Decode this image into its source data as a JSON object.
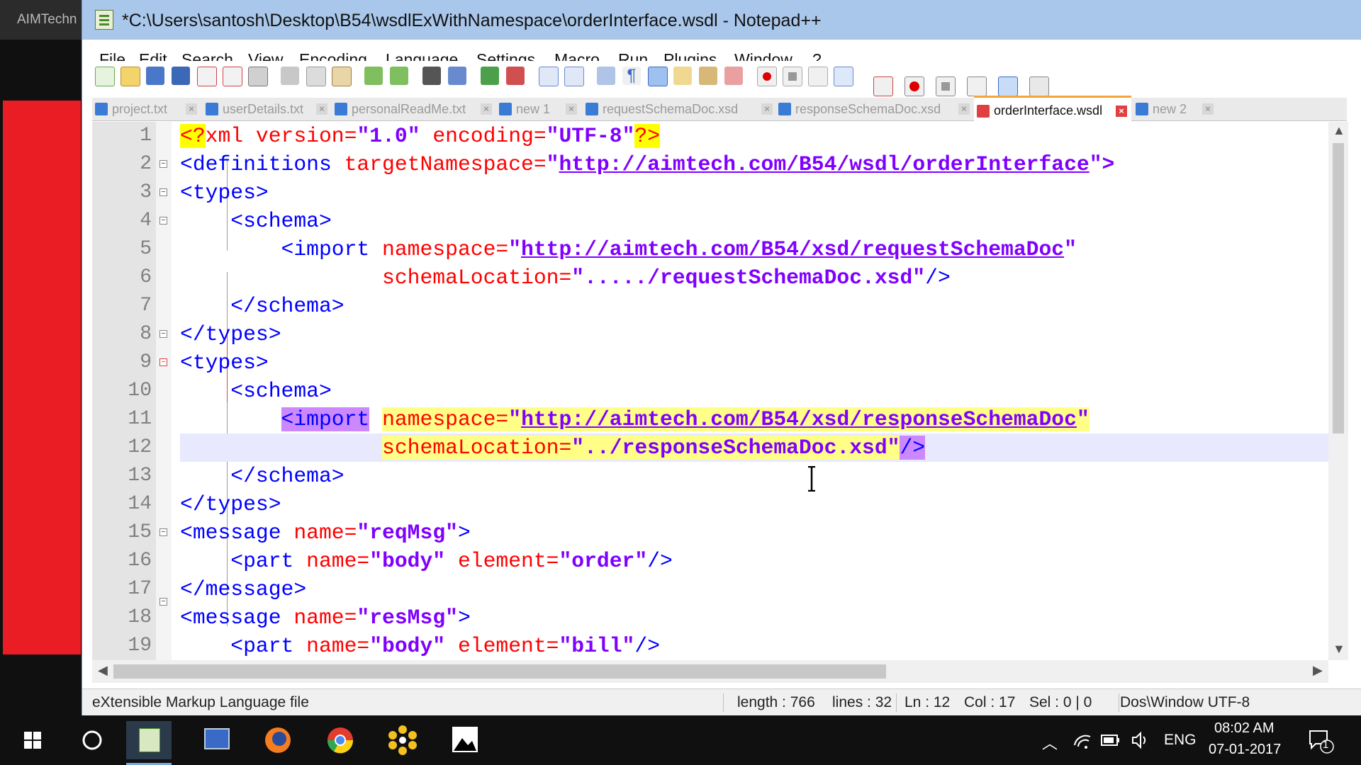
{
  "background": {
    "left_title": "AIMTechn"
  },
  "window": {
    "title": "*C:\\Users\\santosh\\Desktop\\B54\\wsdlExWithNamespace\\orderInterface.wsdl - Notepad++"
  },
  "menu": [
    "File",
    "Edit",
    "Search",
    "View",
    "Encoding",
    "Language",
    "Settings",
    "Macro",
    "Run",
    "Plugins",
    "Window",
    "?"
  ],
  "tabs": [
    {
      "label": "project.txt",
      "active": false
    },
    {
      "label": "userDetails.txt",
      "active": false
    },
    {
      "label": "personalReadMe.txt",
      "active": false
    },
    {
      "label": "new 1",
      "active": false
    },
    {
      "label": "requestSchemaDoc.xsd",
      "active": false
    },
    {
      "label": "responseSchemaDoc.xsd",
      "active": false
    },
    {
      "label": "orderInterface.wsdl",
      "active": true
    },
    {
      "label": "new 2",
      "active": false
    }
  ],
  "editor": {
    "line_numbers": [
      "1",
      "2",
      "3",
      "4",
      "5",
      "6",
      "7",
      "8",
      "9",
      "10",
      "11",
      "12",
      "13",
      "14",
      "15",
      "16",
      "17",
      "18",
      "19"
    ],
    "code_text": {
      "l1_a": "<?",
      "l1_b": "xml ",
      "l1_c": "version=",
      "l1_d": "\"1.0\"",
      "l1_e": " encoding=",
      "l1_f": "\"UTF-8\"",
      "l1_g": "?>",
      "l2_a": "<definitions ",
      "l2_b": "targetNamespace=",
      "l2_c": "\"",
      "l2_d": "http://aimtech.com/B54/wsdl/orderInterface",
      "l2_e": "\">",
      "l3": "<types>",
      "l4": "    <schema>",
      "l5_a": "        <import ",
      "l5_b": "namespace=",
      "l5_c": "\"",
      "l5_d": "http://aimtech.com/B54/xsd/requestSchemaDoc",
      "l5_e": "\"",
      "l6_a": "                ",
      "l6_b": "schemaLocation=",
      "l6_c": "\"...../requestSchemaDoc.xsd\"",
      "l6_d": "/>",
      "l7": "    </schema>",
      "l8": "</types>",
      "l9": "<types>",
      "l10": "    <schema>",
      "l11_a": "        ",
      "l11_b": "<import",
      "l11_c": " ",
      "l11_d": "namespace=",
      "l11_e": "\"",
      "l11_f": "http://aimtech.com/B54/xsd/responseSchemaDoc",
      "l11_g": "\"",
      "l12_a": "                ",
      "l12_b": "schemaLocation=",
      "l12_c": "\"../responseSchemaDoc.xsd\"",
      "l12_d": "/>",
      "l13": "    </schema>",
      "l14": "</types>",
      "l15_a": "<message ",
      "l15_b": "name=",
      "l15_c": "\"reqMsg\"",
      "l15_d": ">",
      "l16_a": "    <part ",
      "l16_b": "name=",
      "l16_c": "\"body\"",
      "l16_d": " element=",
      "l16_e": "\"order\"",
      "l16_f": "/>",
      "l17": "</message>",
      "l18_a": "<message ",
      "l18_b": "name=",
      "l18_c": "\"resMsg\"",
      "l18_d": ">",
      "l19_a": "    <part ",
      "l19_b": "name=",
      "l19_c": "\"body\"",
      "l19_d": " element=",
      "l19_e": "\"bill\"",
      "l19_f": "/>"
    }
  },
  "status": {
    "file_type": "eXtensible Markup Language file",
    "length": "length : 766",
    "lines": "lines : 32",
    "ln": "Ln : 12",
    "col": "Col : 17",
    "sel": "Sel : 0 | 0",
    "eol_enc": "Dos\\Window UTF-8"
  },
  "taskbar": {
    "time": "08:02 AM",
    "date": "07-01-2017",
    "language": "ENG",
    "notifications": "1"
  },
  "colors": {
    "tag": "#0000ff",
    "attr": "#ff0000",
    "value": "#8000ff",
    "titlebar": "#a9c7ea",
    "accent_tab": "#f3a43a",
    "red_panel": "#ea1c24"
  }
}
